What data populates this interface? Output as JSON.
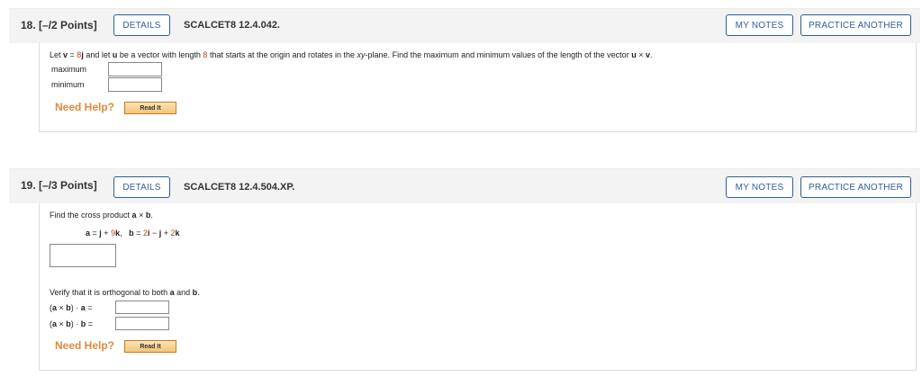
{
  "questions": [
    {
      "number": "18.",
      "points": "[–/2 Points]",
      "details_label": "DETAILS",
      "code": "SCALCET8 12.4.042.",
      "mynotes_label": "MY NOTES",
      "practice_label": "PRACTICE ANOTHER",
      "prompt": {
        "t1": "Let ",
        "v": "v",
        "t2": " = ",
        "eight": "8",
        "j": "j",
        "t3": " and let ",
        "u": "u",
        "t4": " be a vector with length ",
        "len": "8",
        "t5": " that starts at the origin and rotates in the ",
        "xy": "xy",
        "t6": "-plane. Find the maximum and minimum values of the length of the vector ",
        "u2": "u",
        "cross": " × ",
        "v2": "v",
        "period": "."
      },
      "max_label": "maximum",
      "min_label": "minimum",
      "help_label": "Need Help?",
      "readit_label": "Read It"
    },
    {
      "number": "19.",
      "points": "[–/3 Points]",
      "details_label": "DETAILS",
      "code": "SCALCET8 12.4.504.XP.",
      "mynotes_label": "MY NOTES",
      "practice_label": "PRACTICE ANOTHER",
      "prompt": {
        "t1": "Find the cross product ",
        "a": "a",
        "cross": " × ",
        "b": "b",
        "period": "."
      },
      "given": {
        "a": "a",
        "eq1": " = ",
        "j": "j",
        "plus1": " + ",
        "nine": "9",
        "k": "k",
        "comma": ",",
        "b": "b",
        "eq2": " = ",
        "two": "2",
        "i": "i",
        "minus": " − ",
        "j2": "j",
        "plus2": " + ",
        "two2": "2",
        "k2": "k"
      },
      "verify": {
        "t1": "Verify that it is orthogonal to both ",
        "a": "a",
        "t2": " and ",
        "b": "b",
        "period": "."
      },
      "dot_a": {
        "open": "(",
        "a": "a",
        "cross": " × ",
        "b": "b",
        "close": ")",
        "dot": " · ",
        "a2": "a",
        "eq": " ="
      },
      "dot_b": {
        "open": "(",
        "a": "a",
        "cross": " × ",
        "b": "b",
        "close": ")",
        "dot": " · ",
        "b2": "b",
        "eq": " ="
      },
      "help_label": "Need Help?",
      "readit_label": "Read It"
    }
  ]
}
